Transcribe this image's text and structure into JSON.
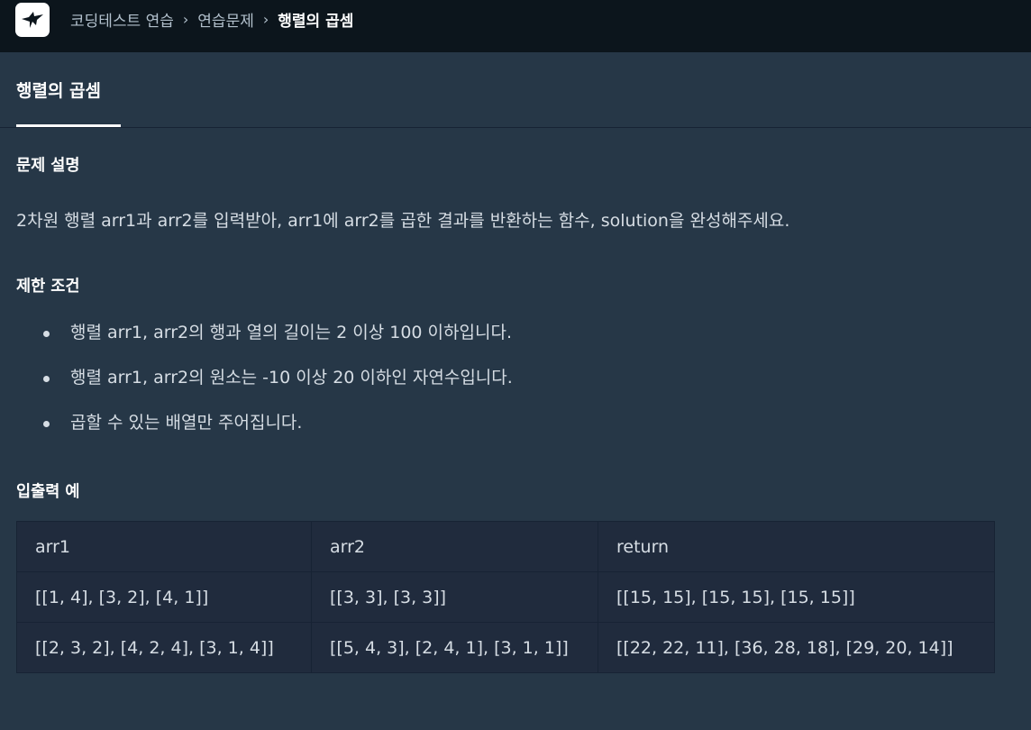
{
  "breadcrumb": {
    "items": [
      "코딩테스트 연습",
      "연습문제"
    ],
    "current": "행렬의 곱셈"
  },
  "tab": {
    "label": "행렬의 곱셈"
  },
  "problem": {
    "description_heading": "문제 설명",
    "description": "2차원 행렬 arr1과 arr2를 입력받아, arr1에 arr2를 곱한 결과를 반환하는 함수, solution을 완성해주세요.",
    "constraints_heading": "제한 조건",
    "constraints": [
      "행렬 arr1, arr2의 행과 열의 길이는 2 이상 100 이하입니다.",
      "행렬 arr1, arr2의 원소는 -10 이상 20 이하인 자연수입니다.",
      "곱할 수 있는 배열만 주어집니다."
    ],
    "examples_heading": "입출력 예"
  },
  "examples": {
    "headers": [
      "arr1",
      "arr2",
      "return"
    ],
    "rows": [
      [
        "[[1, 4], [3, 2], [4, 1]]",
        "[[3, 3], [3, 3]]",
        "[[15, 15], [15, 15], [15, 15]]"
      ],
      [
        "[[2, 3, 2], [4, 2, 4], [3, 1, 4]]",
        "[[5, 4, 3], [2, 4, 1], [3, 1, 1]]",
        "[[22, 22, 11], [36, 28, 18], [29, 20, 14]]"
      ]
    ]
  },
  "icons": {
    "logo": "programmers-bird-logo-icon",
    "separator": "chevron-right-icon"
  }
}
